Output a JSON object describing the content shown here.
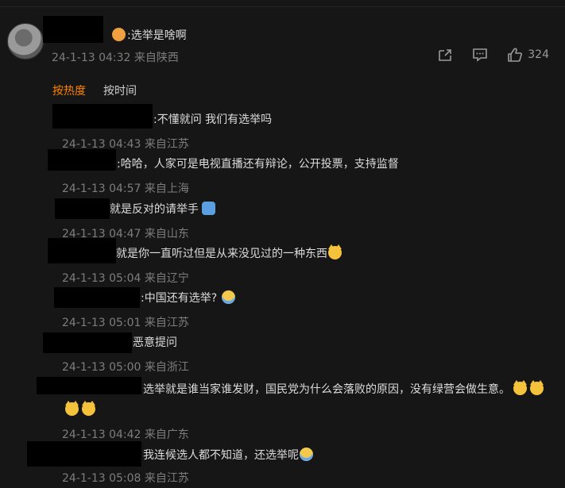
{
  "main_comment": {
    "text": ":选举是啥啊",
    "time": "24-1-13 04:32 来自陕西",
    "likes": "324"
  },
  "sort_tabs": [
    "按热度",
    "按时间"
  ],
  "replies": [
    {
      "text": ":不懂就问 我们有选举吗",
      "time": "24-1-13 04:43 来自江苏",
      "emoji": []
    },
    {
      "text": ":哈哈，人家可是电视直播还有辩论，公开投票，支持监督",
      "time": "24-1-13 04:57 来自上海",
      "emoji": []
    },
    {
      "text": "就是反对的请举手",
      "time": "24-1-13 04:47 来自山东",
      "emoji": [
        "raise-hand-emoji"
      ]
    },
    {
      "text": "就是你一直听过但是从来没见过的一种东西",
      "time": "24-1-13 05:04 来自辽宁",
      "emoji": [
        "cat-emoji"
      ]
    },
    {
      "text": ":中国还有选举?",
      "time": "24-1-13 05:01 来自江苏",
      "emoji": [
        "cry-emoji"
      ]
    },
    {
      "text": "恶意提问",
      "time": "24-1-13 05:00 来自浙江",
      "emoji": []
    },
    {
      "text": "选举就是谁当家谁发财，国民党为什么会落败的原因，没有绿营会做生意。",
      "time": "24-1-13 04:42 来自广东",
      "emoji": [
        "cat-emoji",
        "cat-emoji",
        "cat-emoji",
        "cat-emoji"
      ]
    },
    {
      "text": "我连候选人都不知道，还选举呢",
      "time": "24-1-13 05:08 来自江苏",
      "emoji": [
        "laugh-cry-emoji"
      ]
    }
  ]
}
